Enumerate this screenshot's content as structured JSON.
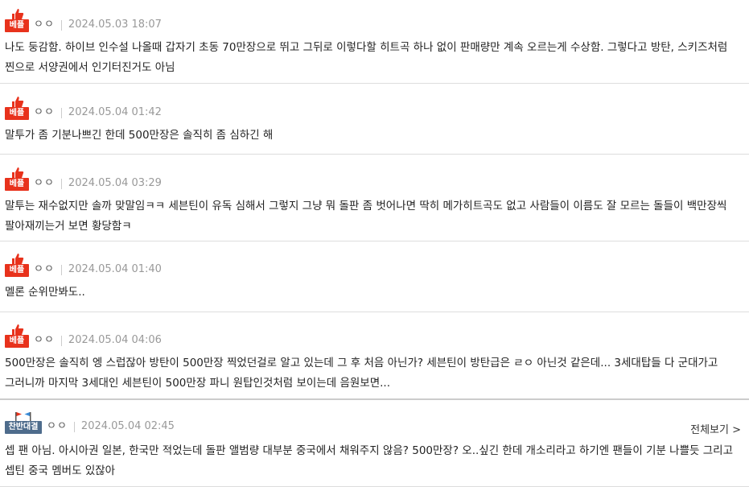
{
  "comments": [
    {
      "badge": "베플",
      "nick": "ㅇㅇ",
      "date": "2024.05.03 18:07",
      "text": "나도 둥감함. 하이브 인수설 나올때 갑자기 초동 70만장으로 뛰고 그뒤로 이렇다할 히트곡 하나 없이 판매량만 계속 오르는게 수상함. 그렇다고 방탄, 스키즈처럼 찐으로 서양권에서 인기터진거도 아님"
    },
    {
      "badge": "베플",
      "nick": "ㅇㅇ",
      "date": "2024.05.04 01:42",
      "text": "말투가 좀 기분나쁘긴 한데 500만장은 솔직히 좀 심하긴 해"
    },
    {
      "badge": "베플",
      "nick": "ㅇㅇ",
      "date": "2024.05.04 03:29",
      "text": "말투는 재수없지만 솔까 맞말임ㅋㅋ 세븐틴이 유독 심해서 그렇지 그냥 뭐 돌판 좀 벗어나면 딱히 메가히트곡도 없고 사람들이 이름도 잘 모르는 돌들이 백만장씩 팔아재끼는거 보면 황당함ㅋ"
    },
    {
      "badge": "베플",
      "nick": "ㅇㅇ",
      "date": "2024.05.04 01:40",
      "text": "멜론 순위만봐도.."
    },
    {
      "badge": "베플",
      "nick": "ㅇㅇ",
      "date": "2024.05.04 04:06",
      "text": "500만장은 솔직히 엥 스럽잖아 방탄이 500만장 찍었던걸로 알고 있는데 그 후 처음 아닌가? 세븐틴이 방탄급은 ㄹㅇ 아닌것 같은데... 3세대탑들 다 군대가고 그러니까 마지막 3세대인 세븐틴이 500만장 파니 원탑인것처럼 보이는데 음원보면..."
    },
    {
      "badge": "찬반대결",
      "nick": "ㅇㅇ",
      "date": "2024.05.04 02:45",
      "text": "셉 팬 아님. 아시아권 일본, 한국만 적었는데 돌판 앨범량 대부분 중국에서 채워주지 않음? 500만장? 오..싶긴 한데 개소리라고 하기엔 팬들이 기분 나쁠듯 그리고 셉틴 중국 멤버도 있잖아",
      "more": "전체보기 >"
    }
  ],
  "colors": {
    "best_badge": "#e8321c",
    "versus_badge": "#4e6c8c"
  }
}
